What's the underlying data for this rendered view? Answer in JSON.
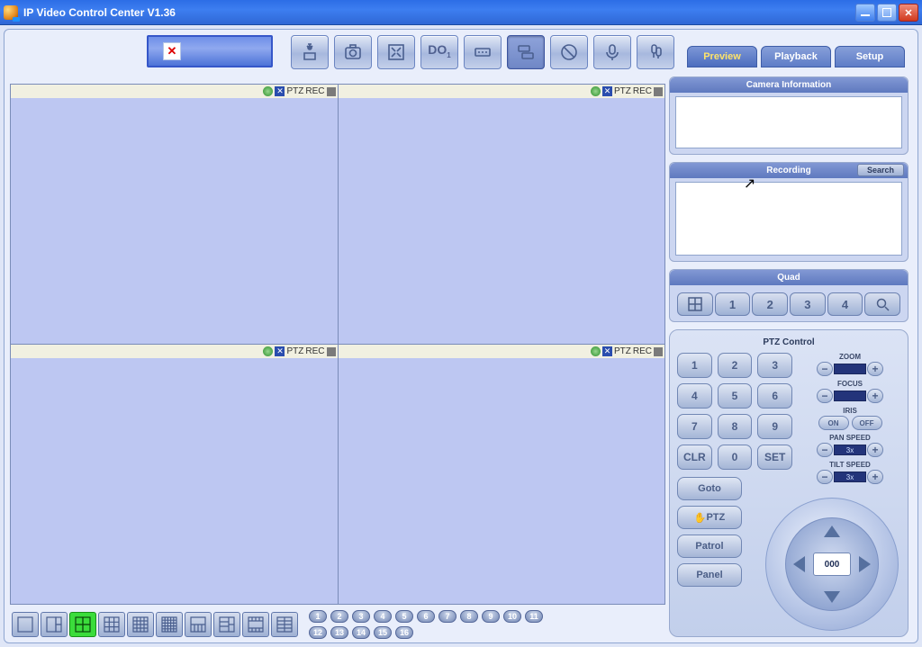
{
  "window": {
    "title": "IP Video Control Center V1.36"
  },
  "tabs": {
    "preview": "Preview",
    "playback": "Playback",
    "setup": "Setup"
  },
  "pane_header": {
    "ptz": "PTZ",
    "rec": "REC"
  },
  "sections": {
    "camera_info": "Camera Information",
    "recording": "Recording",
    "search": "Search",
    "quad": "Quad",
    "ptz_control": "PTZ Control"
  },
  "quad": {
    "b1": "1",
    "b2": "2",
    "b3": "3",
    "b4": "4"
  },
  "keypad": {
    "k1": "1",
    "k2": "2",
    "k3": "3",
    "k4": "4",
    "k5": "5",
    "k6": "6",
    "k7": "7",
    "k8": "8",
    "k9": "9",
    "clr": "CLR",
    "k0": "0",
    "set": "SET"
  },
  "sidebuttons": {
    "goto": "Goto",
    "ptz": "PTZ",
    "patrol": "Patrol",
    "panel": "Panel"
  },
  "ptzcontrols": {
    "zoom": "ZOOM",
    "focus": "FOCUS",
    "iris": "IRIS",
    "iris_on": "ON",
    "iris_off": "OFF",
    "panspeed": "PAN SPEED",
    "tiltspeed": "TILT SPEED",
    "pan_val": "3x",
    "tilt_val": "3x"
  },
  "dpad": {
    "value": "000"
  },
  "channels": {
    "c1": "1",
    "c2": "2",
    "c3": "3",
    "c4": "4",
    "c5": "5",
    "c6": "6",
    "c7": "7",
    "c8": "8",
    "c9": "9",
    "c10": "10",
    "c11": "11",
    "c12": "12",
    "c13": "13",
    "c14": "14",
    "c15": "15",
    "c16": "16"
  },
  "toolbar": {
    "do": "DO"
  }
}
